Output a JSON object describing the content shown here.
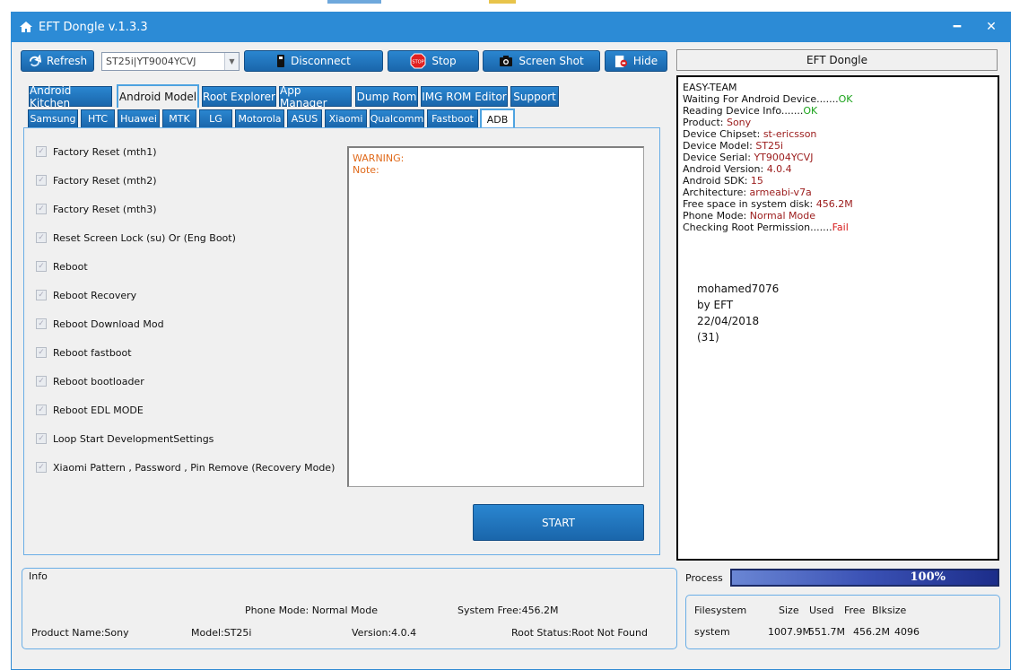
{
  "window": {
    "title": "EFT Dongle  v.1.3.3"
  },
  "toolbar": {
    "refresh": "Refresh",
    "device_select": "ST25i|YT9004YCVJ",
    "disconnect": "Disconnect",
    "stop": "Stop",
    "screenshot": "Screen Shot",
    "hide": "Hide"
  },
  "main_tabs": [
    "Android Kitchen",
    "Android Model",
    "Root Explorer",
    "App Manager",
    "Dump Rom",
    "IMG ROM Editor",
    "Support"
  ],
  "sub_tabs": [
    "Samsung",
    "HTC",
    "Huawei",
    "MTK",
    "LG",
    "Motorola",
    "ASUS",
    "Xiaomi",
    "Qualcomm",
    "Fastboot",
    "ADB"
  ],
  "options": [
    "Factory Reset (mth1)",
    "Factory Reset (mth2)",
    "Factory Reset (mth3)",
    "Reset Screen Lock (su) Or  (Eng Boot)",
    "Reboot",
    "Reboot Recovery",
    "Reboot Download Mod",
    "Reboot fastboot",
    "Reboot bootloader",
    "Reboot EDL MODE",
    "Loop Start  DevelopmentSettings",
    "Xiaomi Pattern , Password , Pin Remove (Recovery Mode)"
  ],
  "warning": {
    "warning": "WARNING:",
    "note": "Note:"
  },
  "start_button": "START",
  "eft_button": "EFT Dongle",
  "log": {
    "team": "EASY-TEAM",
    "waiting": {
      "label": "Waiting For Android Device.......",
      "status": "OK"
    },
    "reading": {
      "label": "Reading Device Info.......",
      "status": "OK"
    },
    "product": {
      "label": "Product: ",
      "value": "Sony"
    },
    "chipset": {
      "label": "Device Chipset: ",
      "value": "st-ericsson"
    },
    "model": {
      "label": "Device Model: ",
      "value": "ST25i"
    },
    "serial": {
      "label": "Device Serial: ",
      "value": "YT9004YCVJ"
    },
    "version": {
      "label": "Android Version: ",
      "value": "4.0.4"
    },
    "sdk": {
      "label": "Android SDK: ",
      "value": "15"
    },
    "arch": {
      "label": "Architecture: ",
      "value": "armeabi-v7a"
    },
    "free": {
      "label": "Free space in system disk: ",
      "value": "456.2M"
    },
    "mode": {
      "label": "Phone Mode: ",
      "value": "Normal Mode"
    },
    "root": {
      "label": "Checking Root Permission.......",
      "status": "Fail"
    },
    "signature": [
      "mohamed7076",
      "by EFT",
      "22/04/2018",
      "(31)"
    ]
  },
  "info": {
    "title": "Info",
    "phone_mode": "Phone Mode: Normal Mode",
    "system_free": "System Free:456.2M",
    "product_name": "Product Name:Sony",
    "model": "Model:ST25i",
    "version": "Version:4.0.4",
    "root_status": "Root Status:Root Not Found"
  },
  "process": {
    "label": "Process",
    "percent_text": "100%",
    "percent": 100
  },
  "filesystem": {
    "headers": [
      "Filesystem",
      "Size",
      "Used",
      "Free",
      "Blksize"
    ],
    "row": [
      "system",
      "1007.9M",
      "551.7M",
      "456.2M",
      "4096"
    ]
  },
  "colors": {
    "accent": "#2c8bd6",
    "ok": "#1ba31b",
    "fail": "#d61a1a",
    "warning": "#e06a1b",
    "value": "#9b1b1b"
  }
}
